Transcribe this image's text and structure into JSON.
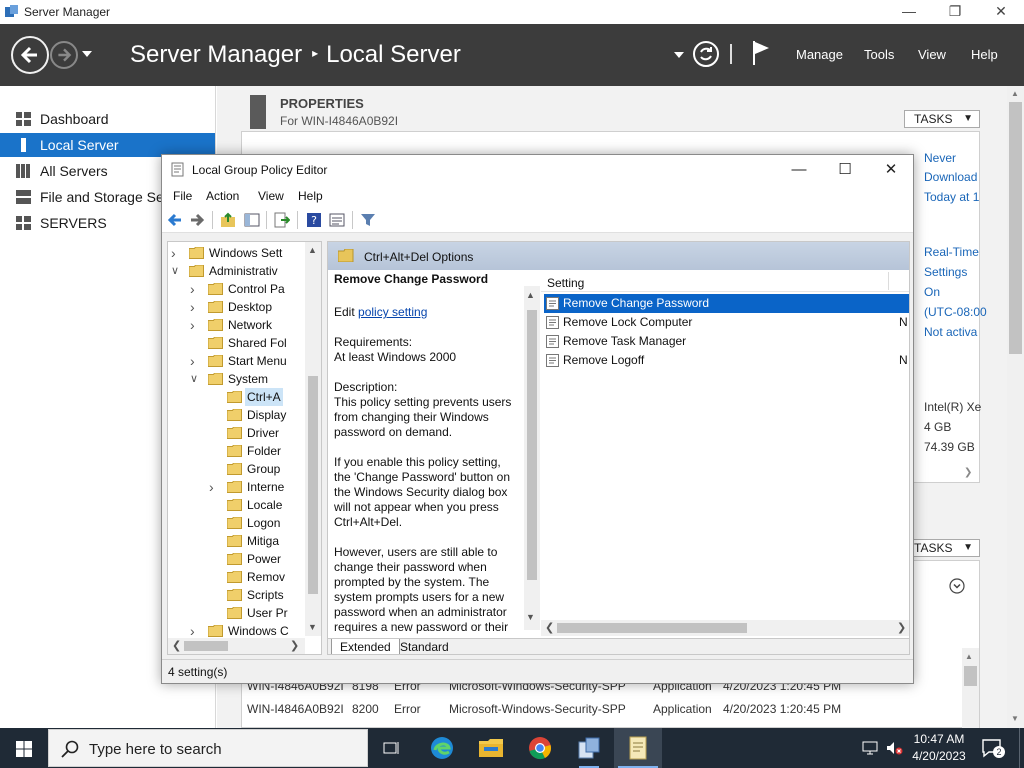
{
  "server_manager": {
    "window_title": "Server Manager",
    "breadcrumb_root": "Server Manager",
    "breadcrumb_sep": "▸",
    "breadcrumb_current": "Local Server",
    "menu": [
      "Manage",
      "Tools",
      "View",
      "Help"
    ],
    "sidebar": [
      {
        "label": "Dashboard",
        "icon": "dashboard-icon"
      },
      {
        "label": "Local Server",
        "icon": "local-server-icon",
        "active": true
      },
      {
        "label": "All Servers",
        "icon": "all-servers-icon"
      },
      {
        "label": "File and Storage Services",
        "icon": "storage-icon"
      },
      {
        "label": "SERVERS",
        "icon": "servers-icon"
      }
    ],
    "properties": {
      "title": "PROPERTIES",
      "subtitle": "For WIN-I4846A0B92I",
      "tasks": "TASKS",
      "values": [
        "Never",
        "Download",
        "Today at 1",
        "Real-Time",
        "Settings",
        "On",
        "(UTC-08:00",
        "Not activa",
        "Intel(R) Xe",
        "4 GB",
        "74.39 GB"
      ]
    },
    "events": {
      "tasks": "TASKS",
      "rows": [
        {
          "server": "WIN-I4846A0B92I",
          "id": "8198",
          "severity": "Error",
          "source": "Microsoft-Windows-Security-SPP",
          "log": "Application",
          "datetime": "4/20/2023 1:20:45 PM"
        },
        {
          "server": "WIN-I4846A0B92I",
          "id": "8200",
          "severity": "Error",
          "source": "Microsoft-Windows-Security-SPP",
          "log": "Application",
          "datetime": "4/20/2023 1:20:45 PM"
        }
      ]
    }
  },
  "gpe": {
    "title": "Local Group Policy Editor",
    "menu": [
      "File",
      "Action",
      "View",
      "Help"
    ],
    "tree": [
      {
        "label": "Windows Sett",
        "indent": 0,
        "expander": ">"
      },
      {
        "label": "Administrativ",
        "indent": 0,
        "expander": "v"
      },
      {
        "label": "Control Pa",
        "indent": 1,
        "expander": ">"
      },
      {
        "label": "Desktop",
        "indent": 1,
        "expander": ">"
      },
      {
        "label": "Network",
        "indent": 1,
        "expander": ">"
      },
      {
        "label": "Shared Fol",
        "indent": 1,
        "expander": ""
      },
      {
        "label": "Start Menu",
        "indent": 1,
        "expander": ">"
      },
      {
        "label": "System",
        "indent": 1,
        "expander": "v"
      },
      {
        "label": "Ctrl+A",
        "indent": 2,
        "expander": "",
        "selected": true
      },
      {
        "label": "Display",
        "indent": 2,
        "expander": ""
      },
      {
        "label": "Driver",
        "indent": 2,
        "expander": ""
      },
      {
        "label": "Folder",
        "indent": 2,
        "expander": ""
      },
      {
        "label": "Group",
        "indent": 2,
        "expander": ""
      },
      {
        "label": "Interne",
        "indent": 2,
        "expander": ">"
      },
      {
        "label": "Locale",
        "indent": 2,
        "expander": ""
      },
      {
        "label": "Logon",
        "indent": 2,
        "expander": ""
      },
      {
        "label": "Mitiga",
        "indent": 2,
        "expander": ""
      },
      {
        "label": "Power",
        "indent": 2,
        "expander": ""
      },
      {
        "label": "Remov",
        "indent": 2,
        "expander": ""
      },
      {
        "label": "Scripts",
        "indent": 2,
        "expander": ""
      },
      {
        "label": "User Pr",
        "indent": 2,
        "expander": ""
      },
      {
        "label": "Windows C",
        "indent": 1,
        "expander": ">"
      }
    ],
    "folder_header": "Ctrl+Alt+Del Options",
    "description": {
      "heading": "Remove Change Password",
      "edit_prefix": "Edit ",
      "edit_link": "policy setting",
      "req_label": "Requirements:",
      "req_value": "At least Windows 2000",
      "desc_label": "Description:",
      "para1": "This policy setting prevents users from changing their Windows password on demand.",
      "para2": "If you enable this policy setting, the 'Change Password' button on the Windows Security dialog box will not appear when you press Ctrl+Alt+Del.",
      "para3": "However, users are still able to change their password when prompted by the system. The system prompts users for a new password when an administrator requires a new password or their"
    },
    "list_header": "Setting",
    "settings": [
      {
        "label": "Remove Change Password",
        "state": "",
        "selected": true
      },
      {
        "label": "Remove Lock Computer",
        "state": "N"
      },
      {
        "label": "Remove Task Manager",
        "state": ""
      },
      {
        "label": "Remove Logoff",
        "state": "N"
      }
    ],
    "tabs": [
      "Extended",
      "Standard"
    ],
    "status": "4 setting(s)"
  },
  "taskbar": {
    "search_placeholder": "Type here to search",
    "time": "10:47 AM",
    "date": "4/20/2023",
    "notification_count": "2"
  }
}
